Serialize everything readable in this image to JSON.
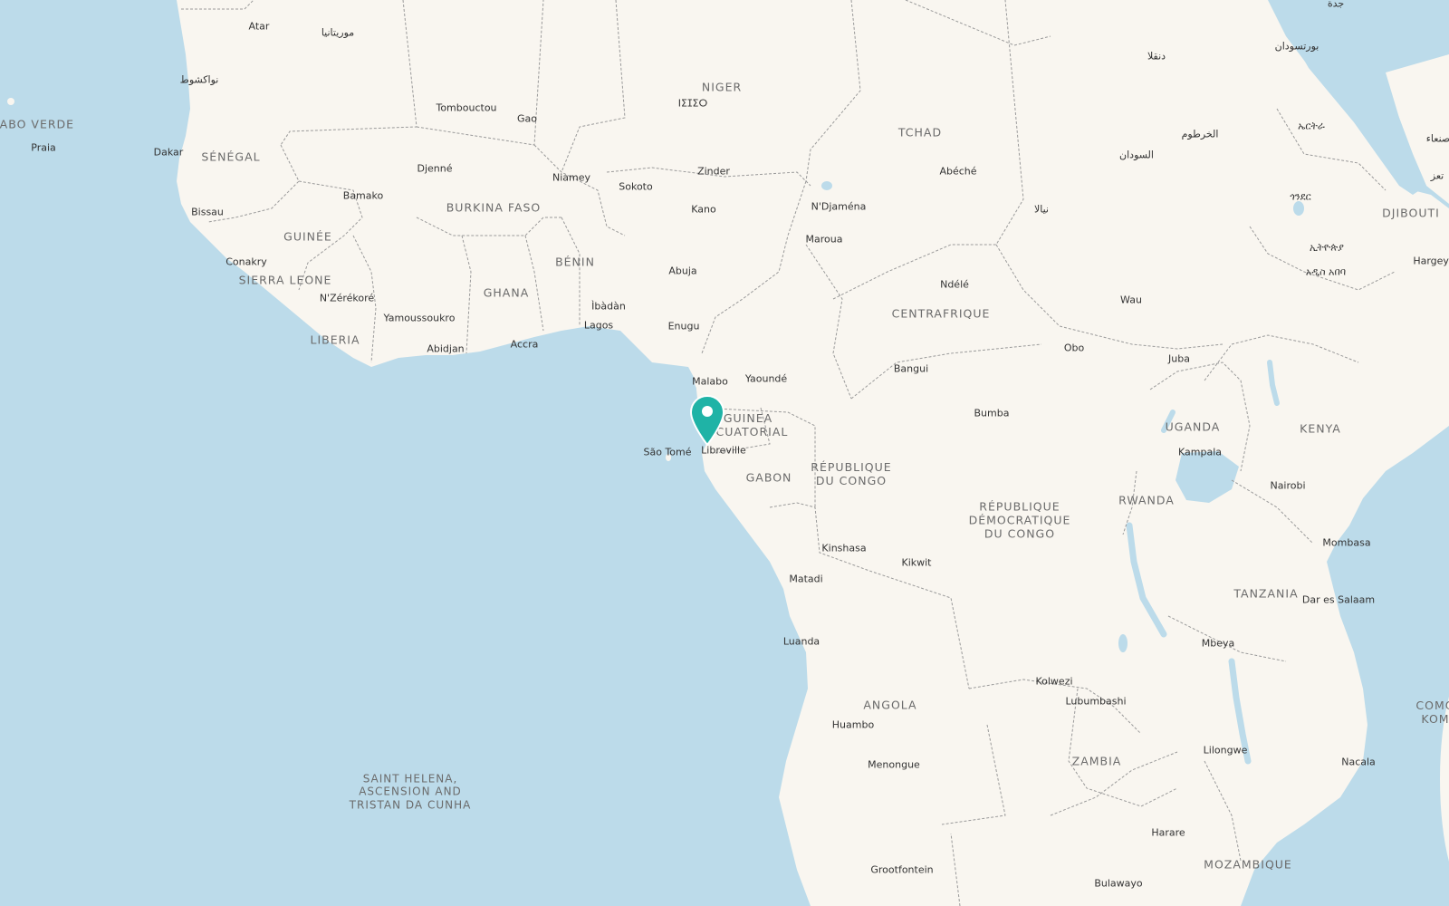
{
  "map": {
    "colors": {
      "water": "#bcdbea",
      "land": "#f9f6f0",
      "border": "#9a9a9a",
      "marker": "#1fb3a6"
    },
    "marker": {
      "icon": "map-pin-icon",
      "place": "Libreville"
    },
    "countries": {
      "niger": "NIGER",
      "tchad": "TCHAD",
      "senegal": "SÉNÉGAL",
      "guinee": "GUINÉE",
      "sierra_leone": "SIERRA LEONE",
      "liberia": "LIBERIA",
      "burkina_faso": "BURKINA FASO",
      "ghana": "GHANA",
      "benin": "BÉNIN",
      "centrafrique": "CENTRAFRIQUE",
      "guinea_ecuatorial": "GUINEA\nECUATORIAL",
      "gabon": "GABON",
      "rep_congo": "RÉPUBLIQUE\nDU CONGO",
      "rdc": "RÉPUBLIQUE\nDÉMOCRATIQUE\nDU CONGO",
      "uganda": "UGANDA",
      "kenya": "KENYA",
      "rwanda": "RWANDA",
      "tanzania": "TANZANIA",
      "angola": "ANGOLA",
      "zambia": "ZAMBIA",
      "mozambique": "MOZAMBIQUE",
      "djibouti": "DJIBOUTI",
      "cabo_verde": "CABO VERDE",
      "comoros": "COMO\nKOM",
      "saint_helena": "SAINT HELENA,\nASCENSION AND\nTRISTAN DA CUNHA"
    },
    "cities": {
      "atar": "Atar",
      "mauritania_ar": "موريتانيا",
      "nouakchott": "نواكشوط",
      "praia": "Praia",
      "dakar": "Dakar",
      "tombouctou": "Tombouctou",
      "gao": "Gao",
      "niger_tif": "ⵏⵉⵊⵉⵔ",
      "djenne": "Djenné",
      "niamey": "Niamey",
      "zinder": "Zinder",
      "sokoto": "Sokoto",
      "bamako": "Bamako",
      "bissau": "Bissau",
      "kano": "Kano",
      "conakry": "Conakry",
      "nzerekore": "N'Zérékoré",
      "yamoussoukro": "Yamoussoukro",
      "abidjan": "Abidjan",
      "accra": "Accra",
      "ibadan": "Ìbàdàn",
      "lagos": "Lagos",
      "abuja": "Abuja",
      "enugu": "Enugu",
      "malabo": "Malabo",
      "yaounde": "Yaoundé",
      "sao_tome": "São Tomé",
      "libreville": "Libreville",
      "ndjamena": "N'Djaména",
      "maroua": "Maroua",
      "abeche": "Abéché",
      "ndele": "Ndélé",
      "bangui": "Bangui",
      "bumba": "Bumba",
      "kinshasa": "Kinshasa",
      "matadi": "Matadi",
      "kikwit": "Kikwit",
      "luanda": "Luanda",
      "huambo": "Huambo",
      "menongue": "Menongue",
      "grootfontein": "Grootfontein",
      "kolwezi": "Kolwezi",
      "lubumbashi": "Lubumbashi",
      "lilongwe": "Lilongwe",
      "harare": "Harare",
      "bulawayo": "Bulawayo",
      "mbeya": "Mbeya",
      "dar_es_salaam": "Dar es Salaam",
      "mombasa": "Mombasa",
      "nairobi": "Nairobi",
      "kampala": "Kampala",
      "juba": "Juba",
      "wau": "Wau",
      "obo": "Obo",
      "nyala": "نيالا",
      "sudan_ar": "السودان",
      "khartoum": "الخرطوم",
      "dongola": "دنقلا",
      "port_sudan": "بورتسودان",
      "jeddah": "جدة",
      "eritrea": "ኤርትራ",
      "gondar": "ጎንደር",
      "ethiopia": "ኢትዮጵያ",
      "addis_ababa": "አዲስ አበባ",
      "hargeysa": "Hargeys",
      "sanaa": "صنعاء",
      "taiz": "تعز",
      "nacala": "Nacala"
    }
  }
}
